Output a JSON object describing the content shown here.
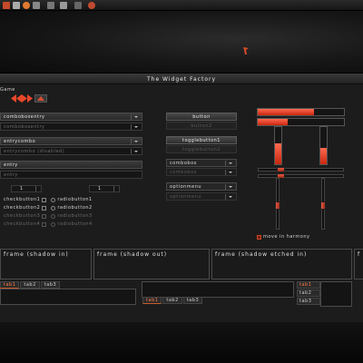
{
  "window": {
    "title": "The Widget Factory",
    "menu": "Game"
  },
  "entries": {
    "comboboxentry_label": "comboboxentry",
    "comboboxentry_value": "comboboxentry",
    "entry_combo_label": "entrycombo",
    "entry_combo_value": "entrycombo (disabled)",
    "entry_label": "entry",
    "entry_value": "entry"
  },
  "spinbuttons": [
    "1",
    "1"
  ],
  "checks": [
    {
      "check": "checkbutton1",
      "radio": "radiobutton1",
      "dim": false
    },
    {
      "check": "checkbutton2",
      "radio": "radiobutton2",
      "dim": false
    },
    {
      "check": "checkbutton3",
      "radio": "radiobutton3",
      "dim": true
    },
    {
      "check": "checkbutton4",
      "radio": "radiobutton4",
      "dim": true
    }
  ],
  "middle": {
    "button": "button",
    "button2": "button2",
    "togglebutton1": "togglebutton1",
    "togglebutton2": "togglebutton2",
    "combobox": "combobox",
    "combobox2": "combobox",
    "optionmenu": "optionmenu",
    "optionmenu2": "optionmenu"
  },
  "harmony_label": "move in harmony",
  "frames": [
    "frame (shadow in)",
    "frame (shadow out)",
    "frame (shadow etched in)",
    "f"
  ],
  "tabs_top": [
    "tab1",
    "tab2",
    "tab3"
  ],
  "tabs_bottom": [
    "tab1",
    "tab2",
    "tab3"
  ],
  "tabs_right": [
    "tab1",
    "tab2",
    "tab3"
  ],
  "levels": {
    "top_bar": 0.65,
    "second_bar": 0.35,
    "vbar_left": 0.55,
    "vbar_right": 0.45
  },
  "colors": {
    "accent": "#e8462a",
    "background": "#1c1c1c"
  }
}
